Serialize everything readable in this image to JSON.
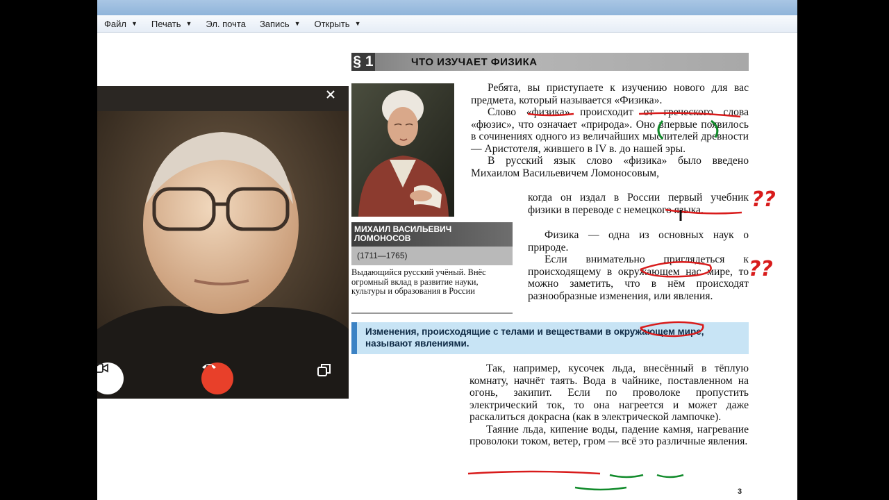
{
  "menu": {
    "file": "Файл",
    "print": "Печать",
    "email": "Эл. почта",
    "record": "Запись",
    "open": "Открыть"
  },
  "page": {
    "section_number": "§ 1",
    "section_title": "ЧТО ИЗУЧАЕТ ФИЗИКА",
    "portrait_caption": {
      "name_line1": "МИХАИЛ ВАСИЛЬЕВИЧ",
      "name_line2": "ЛОМОНОСОВ",
      "years": "(1711—1765)",
      "text": "Выдающийся русский учёный. Внёс огромный вклад в развитие науки, культуры и образования в России"
    },
    "paragraphs": {
      "p1": "Ребята, вы приступаете к изучению нового для вас предмета, который называется «Физика».",
      "p2": "Слово «физика» происходит от греческого слова «фюзис», что означает «природа». Оно впервые появилось в сочинениях одного из величайших мыслителей древности — Аристотеля, жившего в IV в. до нашей эры.",
      "p3a": "В русский язык слово «физика» было введено Михаилом Васильевичем Ломоносовым,",
      "p3b": "когда он издал в России первый учебник физики в переводе с немецкого языка.",
      "p4": "Физика — одна из основных наук о природе.",
      "p5": "Если внимательно приглядеться к происходящему в окружающем нас мире, то можно заметить, что в нём происходят разнообразные изменения, или явления.",
      "definition": "Изменения, происходящие с телами и веществами в окружающем мире, называют явлениями.",
      "p6": "Так, например, кусочек льда, внесённый в тёплую комнату, начнёт таять. Вода в чайнике, поставленном на огонь, закипит. Если по проволоке пропустить электрический ток, то она нагреется и может даже раскалиться докрасна (как в электрической лампочке).",
      "p7": "Таяние льда, кипение воды, падение камня, нагревание проволоки током, ветер, гром — всё это различные явления."
    },
    "page_number": "3",
    "annotations": {
      "qmarks1": "??",
      "qmarks2": "??"
    }
  },
  "video_call": {
    "close_icon": "close-icon",
    "camera_icon": "camera-icon",
    "hangup_icon": "hangup-icon",
    "switch_icon": "switch-window-icon",
    "hangup_color": "#e8402a"
  },
  "colors": {
    "annotation_red": "#d81b1b",
    "annotation_green": "#108a2a",
    "definition_bg": "#c8e4f5"
  }
}
